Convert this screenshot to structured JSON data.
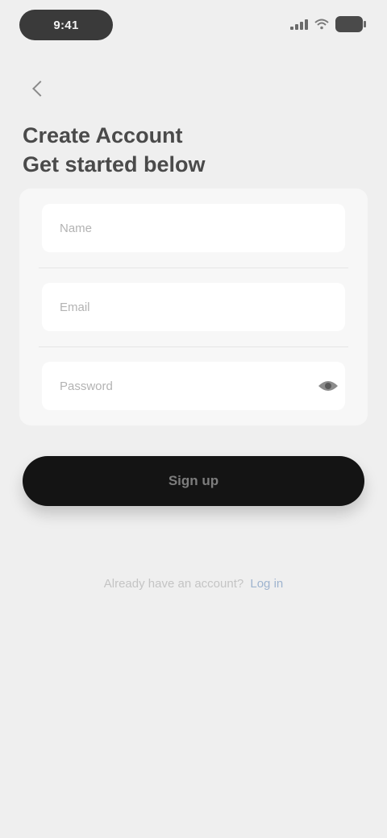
{
  "status_bar": {
    "time": "9:41",
    "signal_icon": "signal-icon",
    "wifi_icon": "wifi-icon",
    "battery_icon": "battery-icon"
  },
  "nav": {
    "back_icon": "chevron-left-icon"
  },
  "header": {
    "title_line1": "Create Account",
    "title_line2": "Get started below"
  },
  "form": {
    "name_placeholder": "Name",
    "email_placeholder": "Email",
    "password_placeholder": "Password",
    "password_toggle_icon": "eye-icon"
  },
  "actions": {
    "submit_label": "Sign up"
  },
  "footer": {
    "prompt": "Already have an account?",
    "link_label": "Log in"
  },
  "colors": {
    "background": "#efefef",
    "card": "#f7f7f7",
    "button": "#141414",
    "link": "#9fb4cf"
  }
}
